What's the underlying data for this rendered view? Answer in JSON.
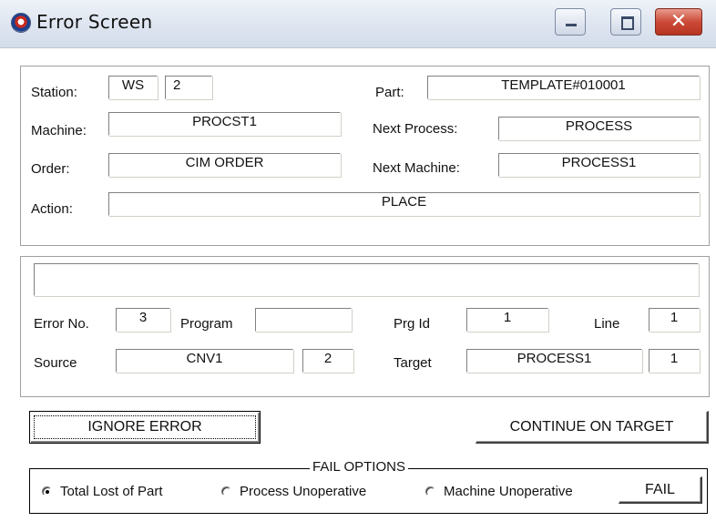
{
  "window": {
    "title": "Error Screen",
    "close_glyph": "✕"
  },
  "header": {
    "station_label": "Station:",
    "station_code": "WS",
    "station_number": "2",
    "machine_label": "Machine:",
    "machine_value": "PROCST1",
    "order_label": "Order:",
    "order_value": "CIM ORDER",
    "action_label": "Action:",
    "action_value": "PLACE",
    "part_label": "Part:",
    "part_value": "TEMPLATE#010001",
    "next_process_label": "Next Process:",
    "next_process_value": "PROCESS",
    "next_machine_label": "Next Machine:",
    "next_machine_value": "PROCESS1"
  },
  "error": {
    "message": "",
    "error_no_label": "Error No.",
    "error_no_value": "3",
    "program_label": "Program",
    "program_value": "",
    "prg_id_label": "Prg Id",
    "prg_id_value": "1",
    "line_label": "Line",
    "line_value": "1",
    "source_label": "Source",
    "source_value": "CNV1",
    "source_number": "2",
    "target_label": "Target",
    "target_value": "PROCESS1",
    "target_number": "1"
  },
  "buttons": {
    "ignore_error": "IGNORE ERROR",
    "continue_on_target": "CONTINUE ON TARGET",
    "fail": "FAIL"
  },
  "fail_options": {
    "legend": "FAIL OPTIONS",
    "options": [
      {
        "label": "Total Lost of Part",
        "selected": true
      },
      {
        "label": "Process Unoperative",
        "selected": false
      },
      {
        "label": "Machine Unoperative",
        "selected": false
      }
    ]
  },
  "icons": {
    "app": "app-logo-icon",
    "minimize": "minimize-icon",
    "maximize": "maximize-icon",
    "close": "close-icon"
  }
}
